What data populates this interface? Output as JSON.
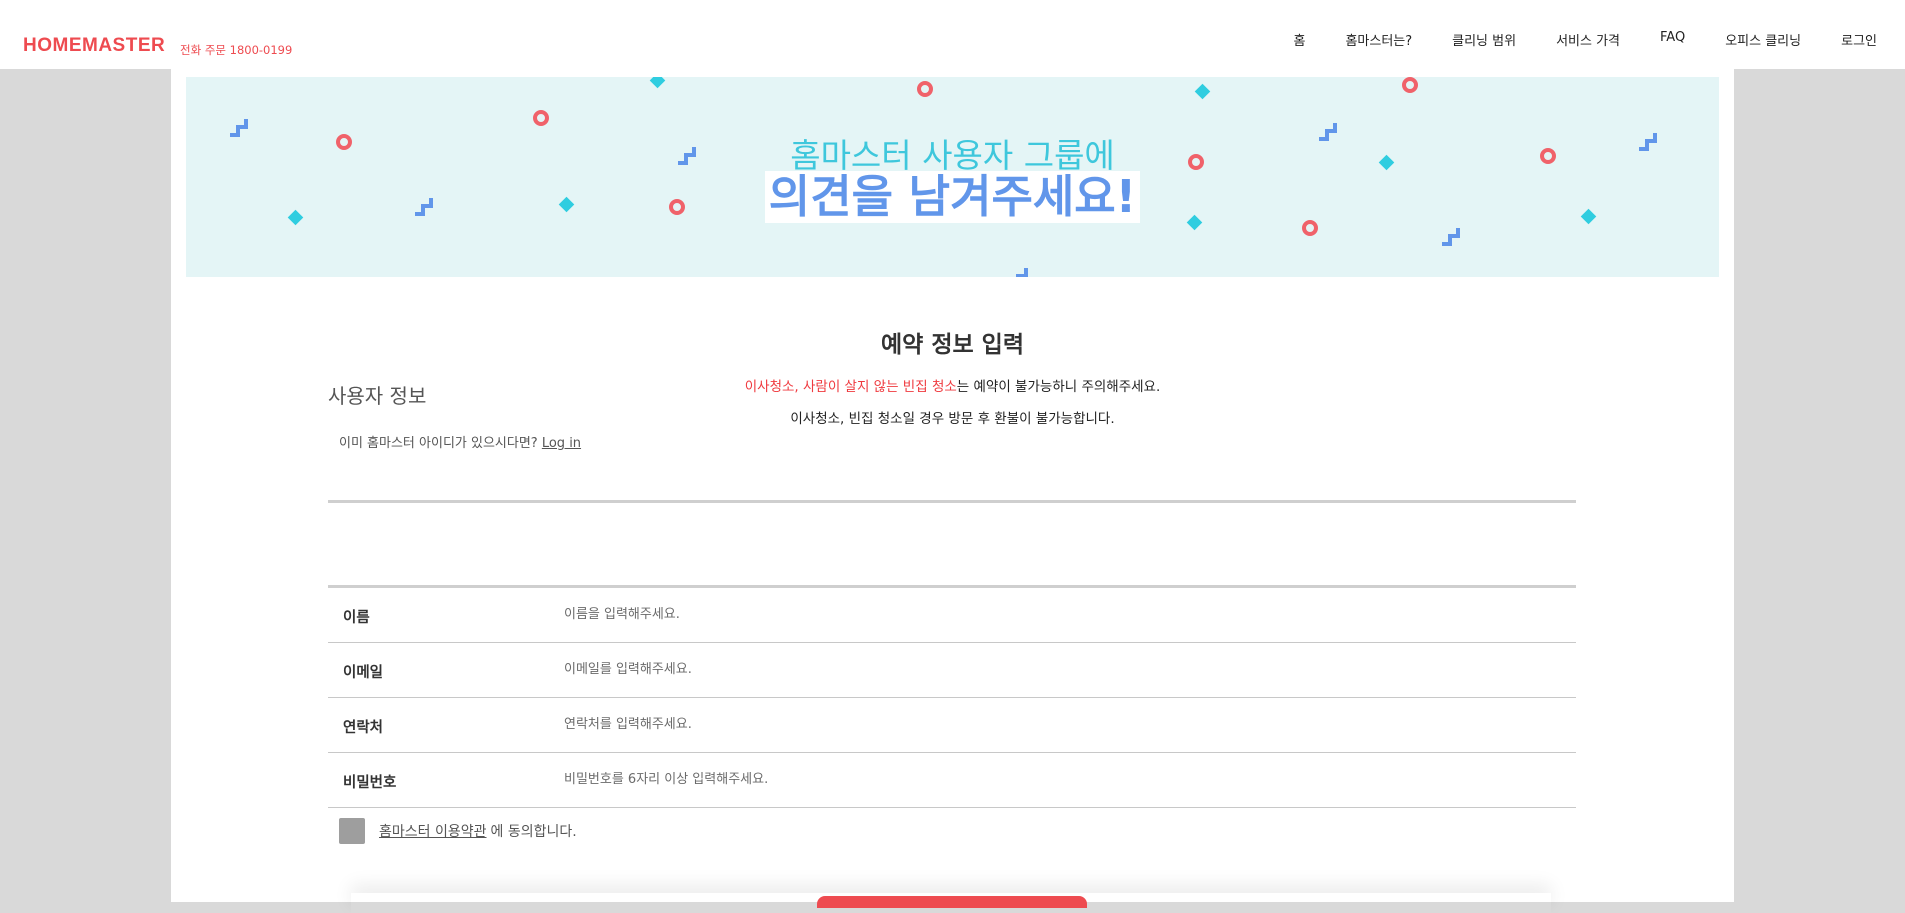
{
  "header": {
    "logo": "HOMEMASTER",
    "phone": "전화 주문 1800-0199",
    "nav": [
      "홈",
      "홈마스터는?",
      "클리닝 범위",
      "서비스 가격",
      "FAQ",
      "오피스 클리닝",
      "로그인"
    ]
  },
  "banner": {
    "subtitle": "홈마스터 사용자 그룹에",
    "title": "의견을 남겨주세요!"
  },
  "reservation": {
    "title": "예약 정보 입력",
    "warning_red": "이사청소, 사람이 살지 않는 빈집 청소",
    "warning_rest": "는 예약이 불가능하니 주의해주세요.",
    "note": "이사청소, 빈집 청소일 경우 방문 후 환불이 불가능합니다."
  },
  "user_section": {
    "title": "사용자 정보",
    "already_text": "이미 홈마스터 아이디가 있으시다면?",
    "login_link": "Log in"
  },
  "form": {
    "fields": [
      {
        "label": "이름",
        "placeholder": "이름을 입력해주세요."
      },
      {
        "label": "이메일",
        "placeholder": "이메일를 입력해주세요."
      },
      {
        "label": "연락처",
        "placeholder": "연락처를 입력해주세요."
      },
      {
        "label": "비밀번호",
        "placeholder": "비밀번호를 6자리 이상 입력해주세요."
      }
    ],
    "agree_link": "홈마스터 이용약관",
    "agree_text": "에 동의합니다."
  },
  "colors": {
    "brand": "#ee4b50",
    "banner_bg": "#e4f5f6",
    "cyan": "#3ec7dc",
    "blue": "#6196ea"
  }
}
